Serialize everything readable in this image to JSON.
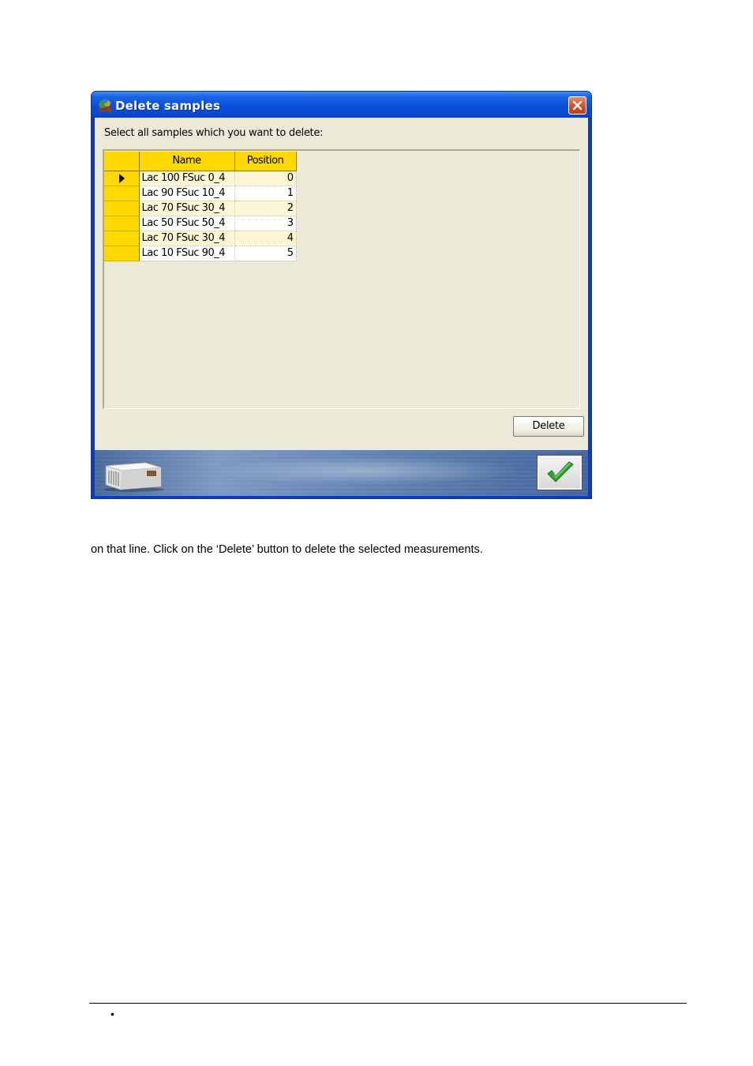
{
  "dialog": {
    "title": "Delete samples",
    "prompt": "Select all samples which you want to delete:",
    "columns": {
      "name": "Name",
      "position": "Position"
    },
    "rows": [
      {
        "name": "Lac 100 FSuc 0_4",
        "position": "0",
        "current": true
      },
      {
        "name": "Lac 90 FSuc 10_4",
        "position": "1",
        "current": false
      },
      {
        "name": "Lac 70 FSuc 30_4",
        "position": "2",
        "current": false
      },
      {
        "name": "Lac 50 FSuc 50_4",
        "position": "3",
        "current": false
      },
      {
        "name": "Lac 70 FSuc 30_4",
        "position": "4",
        "current": false
      },
      {
        "name": "Lac 10 FSuc 90_4",
        "position": "5",
        "current": false
      }
    ],
    "delete_label": "Delete",
    "icons": {
      "title": "app-icon",
      "close": "close-icon",
      "row_indicator": "row-pointer-icon",
      "ok": "checkmark-icon",
      "banner": "instrument-image"
    },
    "colors": {
      "title_bar": "#0b4fdc",
      "grid_header": "#ffd800",
      "client": "#ece9d8",
      "ok_check": "#2fa52f"
    }
  },
  "document": {
    "text": "on that line. Click on the ‘Delete’ button to delete the selected measurements.",
    "bullet": "•"
  }
}
